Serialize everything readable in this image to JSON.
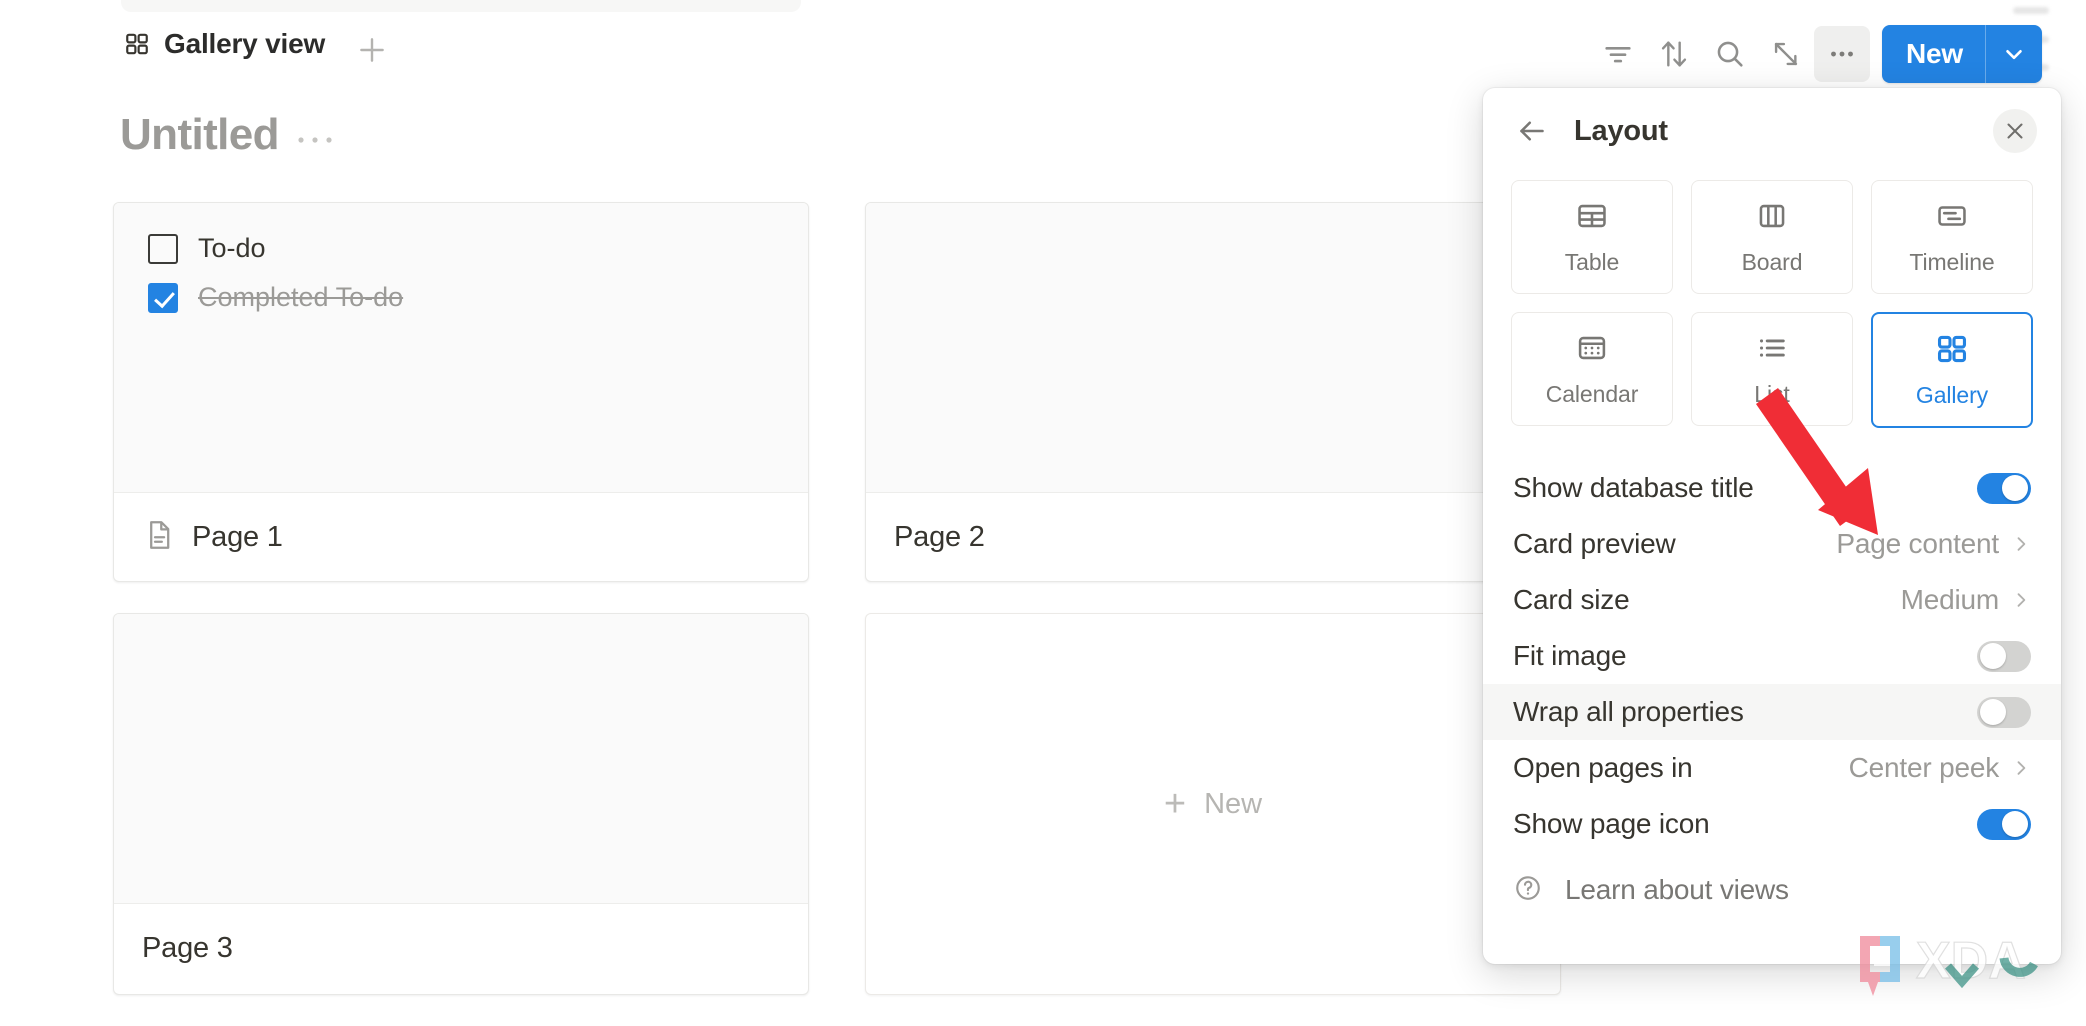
{
  "toolbar": {
    "view_tab_label": "Gallery view",
    "view_tab_icon": "gallery-grid-icon",
    "add_view_icon": "plus-icon",
    "icons": [
      {
        "name": "filter-icon",
        "label": "Filter"
      },
      {
        "name": "sort-icon",
        "label": "Sort"
      },
      {
        "name": "search-icon",
        "label": "Search"
      },
      {
        "name": "expand-icon",
        "label": "Expand"
      },
      {
        "name": "more-options-icon",
        "label": "More options"
      }
    ],
    "new_button_label": "New",
    "new_button_chevron_icon": "chevron-down-icon",
    "new_button_color": "#2383e2"
  },
  "page": {
    "title": "Untitled",
    "title_menu_icon": "ellipsis-icon"
  },
  "gallery": {
    "cards": [
      {
        "name": "Page 1",
        "has_page_icon": true,
        "page_icon": "document-icon",
        "todos": [
          {
            "text": "To-do",
            "checked": false
          },
          {
            "text": "Completed To-do",
            "checked": true
          }
        ]
      },
      {
        "name": "Page 2",
        "has_page_icon": false,
        "page_icon": "",
        "todos": []
      },
      {
        "name": "Page 3",
        "has_page_icon": false,
        "page_icon": "",
        "todos": []
      }
    ],
    "new_card_label": "New",
    "new_card_icon": "plus-icon"
  },
  "panel": {
    "back_icon": "arrow-left-icon",
    "title": "Layout",
    "close_icon": "close-icon",
    "layout_types": [
      {
        "label": "Table",
        "icon": "table-icon",
        "selected": false
      },
      {
        "label": "Board",
        "icon": "board-icon",
        "selected": false
      },
      {
        "label": "Timeline",
        "icon": "timeline-icon",
        "selected": false
      },
      {
        "label": "Calendar",
        "icon": "calendar-icon",
        "selected": false
      },
      {
        "label": "List",
        "icon": "list-icon",
        "selected": false
      },
      {
        "label": "Gallery",
        "icon": "gallery-grid-icon",
        "selected": true
      }
    ],
    "selected_accent": "#2383e2",
    "options": [
      {
        "label": "Show database title",
        "control": "toggle",
        "value": "on",
        "highlight": false
      },
      {
        "label": "Card preview",
        "control": "select",
        "value": "Page content",
        "highlight": false
      },
      {
        "label": "Card size",
        "control": "select",
        "value": "Medium",
        "highlight": false
      },
      {
        "label": "Fit image",
        "control": "toggle",
        "value": "off",
        "highlight": false
      },
      {
        "label": "Wrap all properties",
        "control": "toggle",
        "value": "off",
        "highlight": true
      },
      {
        "label": "Open pages in",
        "control": "select",
        "value": "Center peek",
        "highlight": false
      },
      {
        "label": "Show page icon",
        "control": "toggle",
        "value": "on",
        "highlight": false
      }
    ],
    "footer": {
      "help_icon": "question-circle-icon",
      "label": "Learn about views"
    }
  },
  "annotation": {
    "arrow_color": "#f02d36",
    "arrow_name": "red-callout-arrow"
  },
  "watermark": {
    "text": "XDA"
  }
}
